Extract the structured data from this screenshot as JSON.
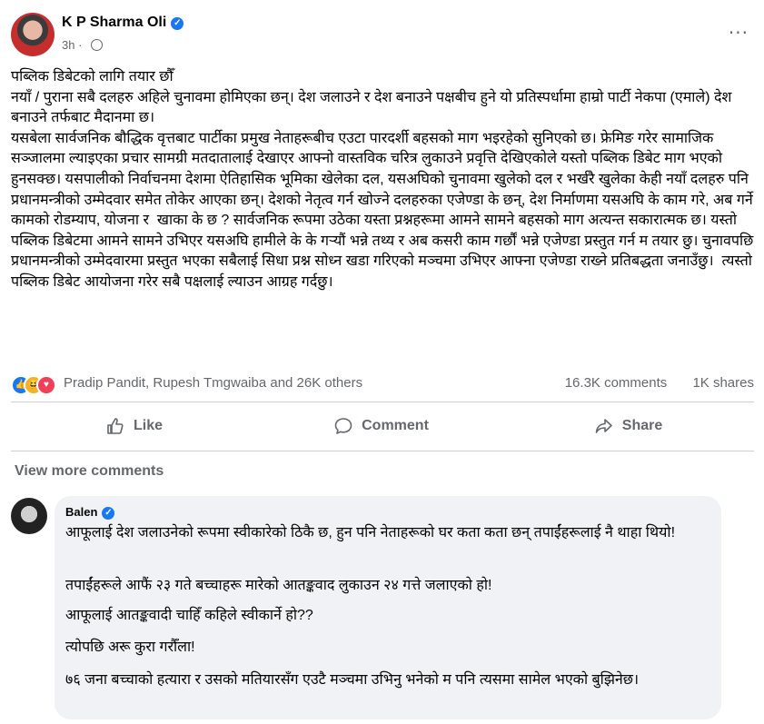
{
  "post": {
    "author": "K P Sharma Oli",
    "time": "3h",
    "dot": "·",
    "more": "···",
    "text": "पब्लिक डिबेटको लागि तयार छौँ\nनयाँ / पुराना सबै दलहरु अहिले चुनावमा होमिएका छन्। देश जलाउने र देश बनाउने पक्षबीच हुने यो प्रतिस्पर्धामा हाम्रो पार्टी नेकपा (एमाले) देश बनाउने तर्फबाट मैदानमा छ।\nयसबेला सार्वजनिक बौद्धिक वृत्तबाट पार्टीका प्रमुख नेताहरूबीच एउटा पारदर्शी बहसको माग भइरहेको सुनिएको छ। फ्रेमिङ गरेर सामाजिक सञ्जालमा ल्याइएका प्रचार सामग्री मतदातालाई देखाएर आफ्नो वास्तविक चरित्र लुकाउने प्रवृत्ति देखिएकोले यस्तो पब्लिक डिबेट माग भएको हुनसक्छ। यसपालीको निर्वाचनमा देशमा ऐतिहासिक भूमिका खेलेका दल, यसअघिको चुनावमा खुलेको दल र भर्खरै खुलेका केही नयाँ दलहरु पनि प्रधानमन्त्रीको उम्मेदवार समेत तोकेर आएका छन्। देशको नेतृत्व गर्न खोज्ने दलहरुका एजेण्डा के छन्, देश निर्माणमा यसअघि के काम गरे, अब गर्ने कामको रोडम्याप, योजना र  खाका के छ ? सार्वजनिक रूपमा उठेका यस्ता प्रश्नहरूमा आमने सामने बहसको माग अत्यन्त सकारात्मक छ। यस्तो पब्लिक डिबेटमा आमने सामने उभिएर यसअघि हामीले के के गर्‍यौं भन्ने तथ्य र अब कसरी काम गर्छौं भन्ने एजेण्डा प्रस्तुत गर्न म तयार छु। चुनावपछि प्रधानमन्त्रीको उम्मेदवारमा प्रस्तुत भएका सबैलाई सिधा प्रश्न सोध्न खडा गरिएको मञ्चमा उभिएर आफ्ना एजेण्डा राख्ने प्रतिबद्धता जनाउँछु।  त्यस्तो पब्लिक डिबेट आयोजना गरेर सबै पक्षलाई ल्याउन आग्रह गर्दछु।"
  },
  "reactions": {
    "names": "Pradip Pandit, Rupesh Tmgwaiba and 26K others",
    "comments": "16.3K comments",
    "shares": "1K shares",
    "colors": {
      "like": "#1877f2",
      "haha": "#f7b125",
      "love": "#f33e58"
    }
  },
  "actions": {
    "like": "Like",
    "comment": "Comment",
    "share": "Share"
  },
  "view_more": "View more comments",
  "comment": {
    "author": "Balen",
    "paragraphs": [
      "आफूलाई देश जलाउनेको रूपमा स्वीकारेको ठिकै छ, हुन पनि नेताहरूको घर कता कता छन् तपाईंहरूलाई नै थाहा थियो!",
      "तपाईंहरूले आफैं २३ गते बच्चाहरू मारेको आतङ्कवाद लुकाउन २४ गत्ते जलाएको हो!",
      "आफूलाई आतङ्कवादी चाहिँ कहिले स्वीकार्ने हो??",
      "त्योपछि अरू कुरा गरौँला!",
      "७६ जना बच्चाको हत्यारा र उसको मतियारसँग एउटै मञ्चमा उभिनु भनेको म पनि त्यसमा सामेल भएको बुझिनेछ।"
    ]
  },
  "colors": {
    "accent": "#1877f2",
    "muted_text": "#65676b",
    "comment_bg": "#f0f2f5"
  }
}
